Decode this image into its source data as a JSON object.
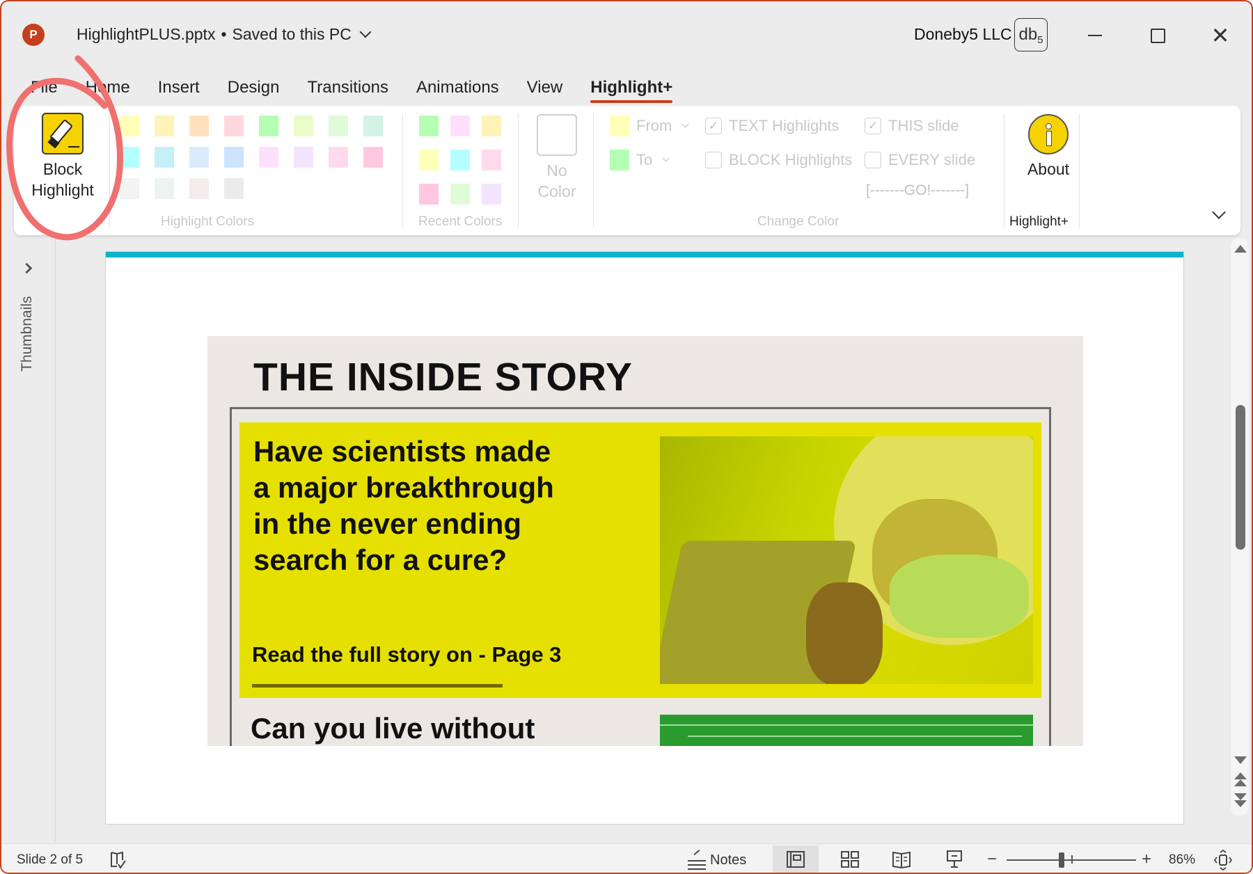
{
  "app": {
    "logo_letter": "P",
    "document_title": "HighlightPLUS.pptx",
    "separator": "•",
    "save_status": "Saved to this PC",
    "account_name": "Doneby5 LLC",
    "account_badge": "db",
    "account_badge_sub": "5",
    "close_glyph": "✕"
  },
  "tabs": [
    {
      "label": "File",
      "active": false
    },
    {
      "label": "Home",
      "active": false
    },
    {
      "label": "Insert",
      "active": false
    },
    {
      "label": "Design",
      "active": false
    },
    {
      "label": "Transitions",
      "active": false
    },
    {
      "label": "Animations",
      "active": false
    },
    {
      "label": "View",
      "active": false
    },
    {
      "label": "Highlight+",
      "active": true
    }
  ],
  "ribbon": {
    "block_highlight": {
      "line1": "Block",
      "line2": "Highlight"
    },
    "highlight_colors": {
      "label": "Highlight Colors",
      "swatches": [
        "#ffffb8",
        "#fff4b8",
        "#ffe2bd",
        "#ffd8de",
        "#b4ffb4",
        "#eafbc9",
        "#dffbd9",
        "#d3f3e6",
        "#b4ffff",
        "#c6f0f8",
        "#dbebfd",
        "#cce4fd",
        "#ffe0fc",
        "#f5e4fe",
        "#ffdaed",
        "#ffc8e0",
        "#f2f3f2",
        "#ecf4f1",
        "#f4ebec",
        "#ebebeb"
      ]
    },
    "recent_colors": {
      "label": "Recent Colors",
      "swatches": [
        "#b4ffb4",
        "#ffe0fc",
        "#fff4b8",
        "#ffffb8",
        "#b4ffff",
        "#ffdaed",
        "#ffc8e0",
        "#dffbd9",
        "#f5e4fe"
      ]
    },
    "no_color": {
      "line1": "No",
      "line2": "Color"
    },
    "change_color": {
      "label": "Change Color",
      "from_label": "From",
      "from_color": "#ffffb8",
      "to_label": "To",
      "to_color": "#b4ffb4",
      "text_highlights": {
        "label": "TEXT Highlights",
        "checked": true
      },
      "block_highlights": {
        "label": "BLOCK Highlights",
        "checked": false
      },
      "this_slide": {
        "label": "THIS slide",
        "checked": true
      },
      "every_slide": {
        "label": "EVERY slide",
        "checked": false
      },
      "go_label": "[-------GO!-------]",
      "check_glyph": "✓"
    },
    "about": {
      "label": "About",
      "group_label": "Highlight+"
    }
  },
  "left_panel": {
    "label": "Thumbnails"
  },
  "slide": {
    "accent_color": "#0ab4c8",
    "title": "THE INSIDE STORY",
    "headline_lines": [
      "Have scientists made",
      "a major breakthrough",
      "in the never ending",
      "search for a cure?"
    ],
    "read_more": "Read the full story on -  Page 3",
    "headline2": "Can you live without",
    "highlight_color": "#e6e000"
  },
  "statusbar": {
    "slide_counter": "Slide 2 of 5",
    "notes_label": "Notes",
    "zoom_minus": "−",
    "zoom_plus": "+",
    "zoom_value": "86%",
    "zoom_percent": 86
  }
}
